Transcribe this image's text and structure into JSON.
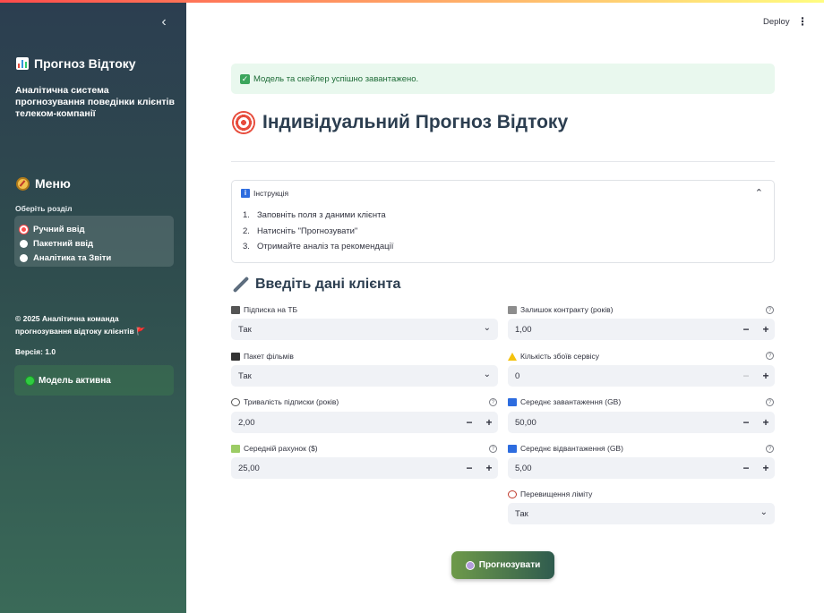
{
  "header": {
    "deploy_label": "Deploy",
    "menu_icon": "kebab-menu-icon"
  },
  "sidebar": {
    "title": "Прогноз Відтоку",
    "description": "Аналітична система прогнозування поведінки клієнтів телеком-компанії",
    "menu_title": "Меню",
    "section_label": "Оберіть розділ",
    "options": [
      {
        "label": "Ручний ввід",
        "selected": true
      },
      {
        "label": "Пакетний ввід",
        "selected": false
      },
      {
        "label": "Аналітика та Звіти",
        "selected": false
      }
    ],
    "copyright": "© 2025 Аналітична команда прогнозування відтоку клієнтів 🚩",
    "version": "Версія: 1.0",
    "model_status": "Модель активна"
  },
  "main": {
    "success_message": "Модель та скейлер успішно завантажено.",
    "title": "Індивідуальний Прогноз Відтоку",
    "instructions": {
      "title": "Інструкція",
      "steps": [
        {
          "num": "1.",
          "text": "Заповніть поля з даними клієнта"
        },
        {
          "num": "2.",
          "text": "Натисніть \"Прогнозувати\""
        },
        {
          "num": "3.",
          "text": "Отримайте аналіз та рекомендації"
        }
      ]
    },
    "section_title": "Введіть дані клієнта",
    "fields": {
      "tv_subscription": {
        "label": "Підписка на ТБ",
        "value": "Так"
      },
      "contract_remaining": {
        "label": "Залишок контракту (років)",
        "value": "1,00"
      },
      "movie_package": {
        "label": "Пакет фільмів",
        "value": "Так"
      },
      "service_failures": {
        "label": "Кількість збоїв сервісу",
        "value": "0"
      },
      "subscription_age": {
        "label": "Тривалість підписки (років)",
        "value": "2,00"
      },
      "avg_download": {
        "label": "Середнє завантаження (GB)",
        "value": "50,00"
      },
      "avg_bill": {
        "label": "Середній рахунок ($)",
        "value": "25,00"
      },
      "avg_upload": {
        "label": "Середнє відвантаження (GB)",
        "value": "5,00"
      },
      "over_limit": {
        "label": "Перевищення ліміту",
        "value": "Так"
      }
    },
    "predict_button": "Прогнозувати"
  },
  "colors": {
    "accent": "#ff4b4b",
    "sidebar_top": "#2c3e50",
    "sidebar_bottom": "#3a6a58",
    "success_bg": "#e9f8ee",
    "input_bg": "#f0f2f6"
  }
}
